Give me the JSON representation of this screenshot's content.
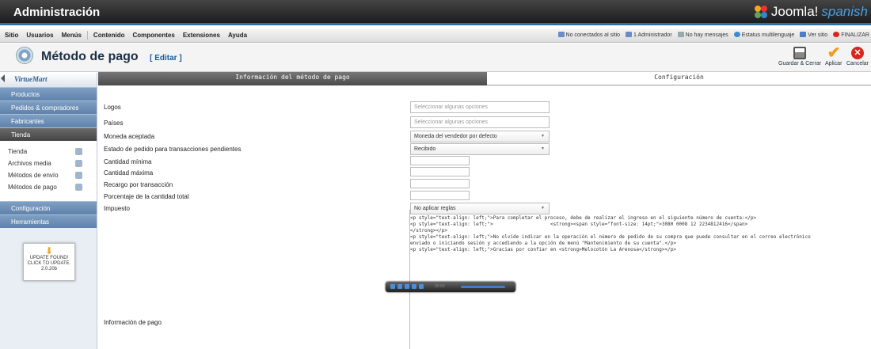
{
  "header": {
    "title": "Administración",
    "brand_main": "Joomla!",
    "brand_sub": "spanish"
  },
  "menu": [
    "Sitio",
    "Usuarios",
    "Menús",
    "Contenido",
    "Componentes",
    "Extensiones",
    "Ayuda"
  ],
  "status": [
    {
      "icon": "users-icon",
      "label": "No conectados al sitio",
      "color": "#6a8cc8"
    },
    {
      "icon": "admin-icon",
      "label": "1 Administrador",
      "color": "#6a8cc8"
    },
    {
      "icon": "messages-icon",
      "label": "No hay mensajes",
      "color": "#9aa"
    },
    {
      "icon": "language-icon",
      "label": "Estatus multilenguaje",
      "color": "#3a8ad8"
    },
    {
      "icon": "view-site-icon",
      "label": "Ver sitio",
      "color": "#4a7fc8"
    },
    {
      "icon": "logout-icon",
      "label": "FINALIZAR",
      "color": "#d9261c"
    }
  ],
  "page": {
    "title": "Método de pago",
    "edit": "[ Editar ]"
  },
  "toolbar": {
    "save_close": "Guardar & Cerrar",
    "apply": "Aplicar",
    "cancel": "Cancelar"
  },
  "sidebar": {
    "logo": "VirtueMart",
    "top_items": [
      "Productos",
      "Pedidos & compradores",
      "Fabricantes",
      "Tienda"
    ],
    "sub_items": [
      "Tienda",
      "Archivos media",
      "Métodos de envío",
      "Métodos de pago"
    ],
    "bottom_items": [
      "Configuración",
      "Herramientas"
    ],
    "update": "UPDATE FOUND! CLICK TO UPDATE.",
    "version": "2.0.20b"
  },
  "tabs": {
    "info": "Información del método de pago",
    "config": "Configuración"
  },
  "form": {
    "logos": "Logos",
    "logos_placeholder": "Seleccionar algunas opciones",
    "countries": "Países",
    "countries_placeholder": "Seleccionar algunas opciones",
    "currency": "Moneda aceptada",
    "currency_value": "Moneda del vendedor por defecto",
    "order_status": "Estado de pedido para transacciones pendientes",
    "order_status_value": "Recibido",
    "min_amount": "Cantidad mínima",
    "max_amount": "Cantidad máxima",
    "surcharge": "Recargo por transacción",
    "percentage": "Porcentaje de la cantidad total",
    "tax": "Impuesto",
    "tax_value": "No aplicar reglas",
    "payment_info": "Información de pago"
  },
  "editor": {
    "content": "<p style=\"text-align: left;\">Para completar el proceso, debe de realizar el ingreso en el siguiente número de cuenta:</p>\n<p style=\"text-align: left;\">                    <strong><span style=\"font-size: 14pt;\">3080 0008 12 2234812416</span>\n</strong></p>\n<p style=\"text-align: left;\">No olvide indicar en la operación el número de pedido de su compra que puede consultar en el correo electrónico\nenviado o iniciando sesión y accediendo a la opción de menú \"Mantenimiento de su cuenta\".</p>\n<p style=\"text-align: left;\">Gracias por confiar en <strong>Melocotón La Arenosa</strong></p>"
  },
  "player": {
    "time": "00:00"
  }
}
